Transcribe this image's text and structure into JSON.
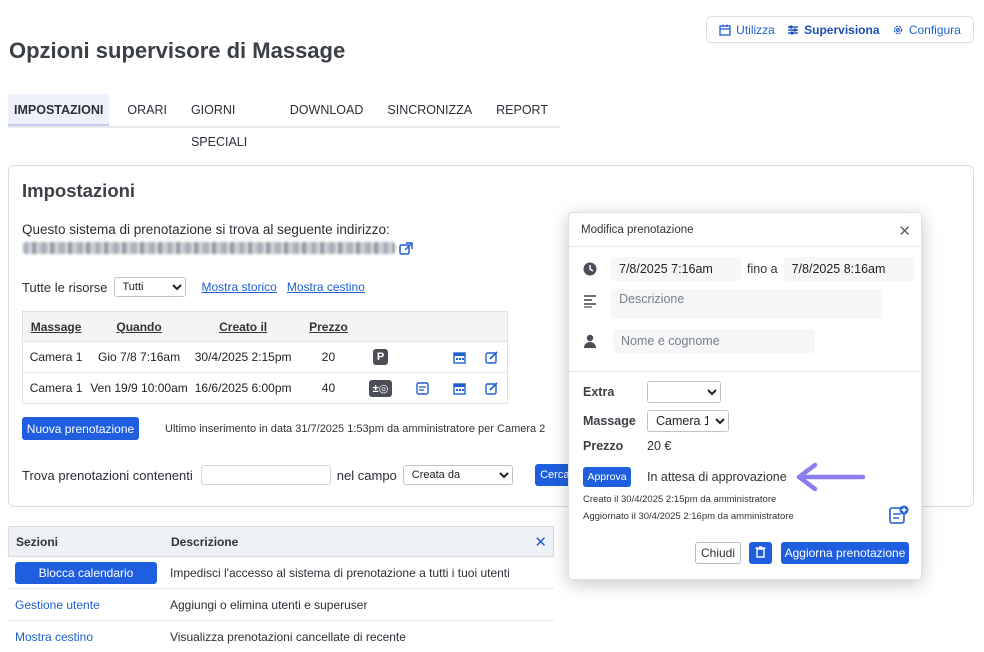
{
  "modes": [
    {
      "label": "Utilizza",
      "icon": "calendar-icon",
      "active": false
    },
    {
      "label": "Supervisiona",
      "icon": "sliders-icon",
      "active": true
    },
    {
      "label": "Configura",
      "icon": "gear-icon",
      "active": false
    }
  ],
  "page_title": "Opzioni supervisore di Massage",
  "tabs": [
    "IMPOSTAZIONI",
    "ORARI",
    "GIORNI SPECIALI",
    "DOWNLOAD",
    "SINCRONIZZA",
    "REPORT"
  ],
  "settings": {
    "title": "Impostazioni",
    "address_label": "Questo sistema di prenotazione si trova al seguente indirizzo:",
    "resources_label": "Tutte le risorse",
    "resources_value": "Tutti",
    "show_history": "Mostra storico",
    "show_trash": "Mostra cestino",
    "table": {
      "headers": [
        "Massage",
        "Quando",
        "Creato il",
        "Prezzo"
      ],
      "rows": [
        {
          "massage": "Camera 1",
          "when": "Gio 7/8 7:16am",
          "created": "30/4/2025 2:15pm",
          "price": "20",
          "badge": "P"
        },
        {
          "massage": "Camera 1",
          "when": "Ven 19/9 10:00am",
          "created": "16/6/2025 6:00pm",
          "price": "40",
          "badge": "±◎"
        }
      ]
    },
    "new_booking": "Nuova prenotazione",
    "last_insert": "Ultimo inserimento in data 31/7/2025 1:53pm da amministratore per Camera 2",
    "search_label": "Trova prenotazioni contenenti",
    "field_label": "nel campo",
    "field_value": "Creata da",
    "search_button": "Cerca"
  },
  "sections": {
    "headers": [
      "Sezioni",
      "Descrizione"
    ],
    "rows": [
      {
        "name": "Blocca calendario",
        "desc": "Impedisci l'accesso al sistema di prenotazione a tutti i tuoi utenti"
      },
      {
        "name": "Gestione utente",
        "desc": "Aggiungi o elimina utenti e superuser"
      },
      {
        "name": "Mostra cestino",
        "desc": "Visualizza prenotazioni cancellate di recente"
      }
    ]
  },
  "modal": {
    "title": "Modifica prenotazione",
    "start": "7/8/2025 7:16am",
    "to_label": "fino a",
    "end": "7/8/2025 8:16am",
    "description_placeholder": "Descrizione",
    "name_placeholder": "Nome e cognome",
    "extra_label": "Extra",
    "massage_label": "Massage",
    "massage_value": "Camera 1",
    "price_label": "Prezzo",
    "price_value": "20 €",
    "approve_button": "Approva",
    "status": "In attesa di approvazione",
    "created_note": "Creato il 30/4/2025 2:15pm da amministratore",
    "updated_note": "Aggiornato il 30/4/2025 2:16pm da amministratore",
    "close_button": "Chiudi",
    "update_button": "Aggiorna prenotazione"
  },
  "colors": {
    "accent": "#1f5fdf",
    "arrow": "#8b7cf0"
  }
}
